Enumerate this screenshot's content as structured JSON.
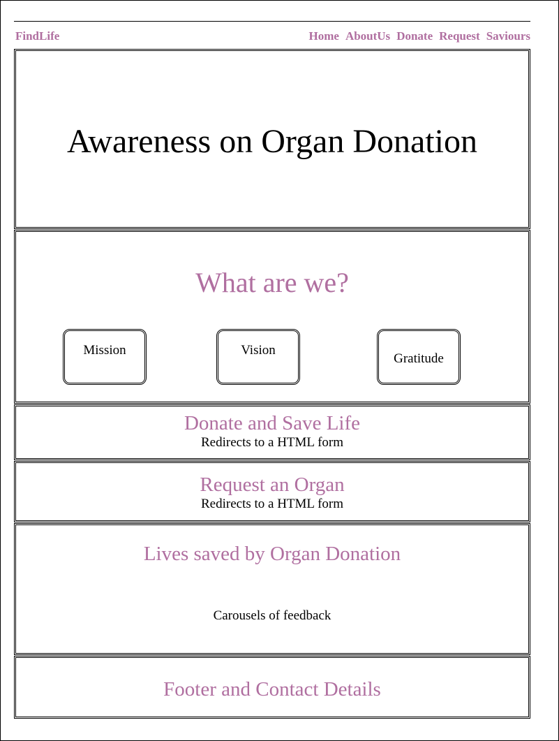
{
  "nav": {
    "brand": "FindLife",
    "links": [
      "Home",
      "AboutUs",
      "Donate",
      "Request",
      "Saviours"
    ]
  },
  "hero": {
    "title": "Awareness on Organ Donation"
  },
  "about": {
    "title": "What are we?",
    "cards": [
      "Mission",
      "Vision",
      "Gratitude"
    ]
  },
  "donate": {
    "title": "Donate and Save Life",
    "note": "Redirects to a HTML form"
  },
  "request": {
    "title": "Request an Organ",
    "note": "Redirects to a HTML form"
  },
  "lives": {
    "title": "Lives saved by Organ Donation",
    "note": "Carousels of feedback"
  },
  "footer": {
    "title": "Footer and Contact Details"
  },
  "colors": {
    "accent": "#b06fa0",
    "border": "#000000",
    "background": "#ffffff"
  }
}
